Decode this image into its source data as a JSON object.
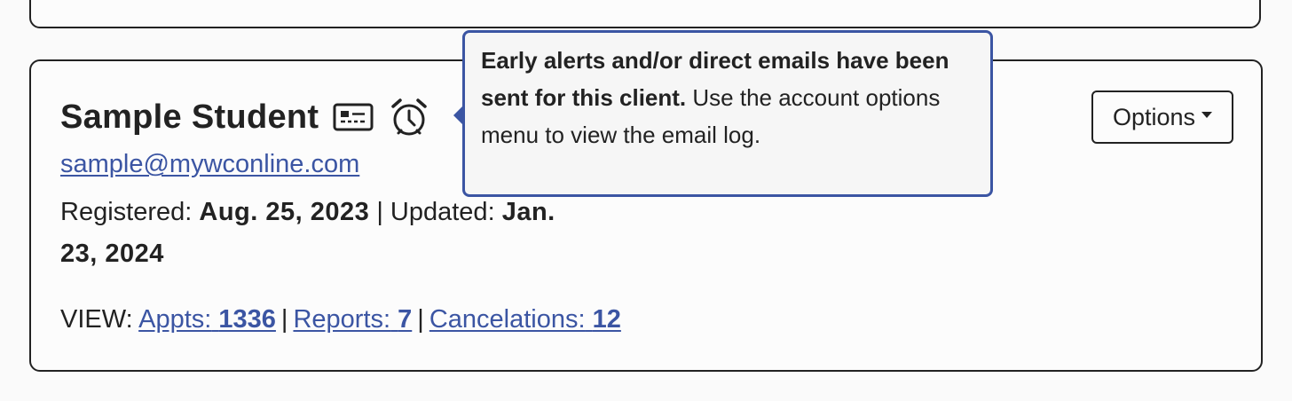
{
  "student": {
    "name": "Sample Student",
    "email": "sample@mywconline.com",
    "registered_label": "Registered:",
    "registered_date": "Aug. 25, 2023",
    "separator": "|",
    "updated_label": "Updated:",
    "updated_date": "Jan. 23, 2024"
  },
  "view": {
    "label": "VIEW:",
    "appts_label": "Appts:",
    "appts_count": "1336",
    "reports_label": "Reports:",
    "reports_count": "7",
    "cancelations_label": "Cancelations:",
    "cancelations_count": "12",
    "separator": "|"
  },
  "options": {
    "label": "Options"
  },
  "tooltip": {
    "bold_text": "Early alerts and/or direct emails have been sent for this client.",
    "body_text": "Use the account options menu to view the email log."
  },
  "icons": {
    "id_card": "id-card-icon",
    "alarm": "alarm-clock-icon",
    "dropdown": "caret-down-icon"
  },
  "colors": {
    "link": "#3b55a3",
    "tooltip_border": "#3b55a3",
    "text": "#222222",
    "card_border": "#222222"
  }
}
